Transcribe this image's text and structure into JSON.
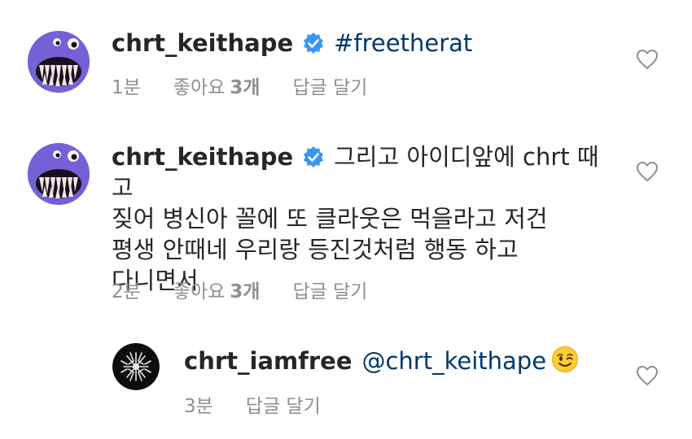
{
  "comments": [
    {
      "username": "chrt_keithape",
      "verified": true,
      "text": "#freetherat",
      "time": "1분",
      "likes_label": "좋아요",
      "likes_count": "3개",
      "reply_label": "답글 달기"
    },
    {
      "username": "chrt_keithape",
      "verified": true,
      "text_lines": [
        "그리고 아이디앞에 chrt 때고",
        "짖어 병신아 꼴에 또 클라웃은 먹을라고 저건",
        "평생 안때네 우리랑 등진것처럼 행동 하고",
        "다니면서"
      ],
      "time": "2분",
      "likes_label": "좋아요",
      "likes_count": "3개",
      "reply_label": "답글 달기"
    },
    {
      "username": "chrt_iamfree",
      "verified": false,
      "mention": "@chrt_keithape",
      "emoji": "winking-face-emoji",
      "time": "3분",
      "reply_label": "답글 달기"
    }
  ],
  "colors": {
    "text": "#262626",
    "meta": "#8e8e8e",
    "link": "#00376b",
    "verified_badge": "#3897f0",
    "heart_outline": "#8e8e8e"
  },
  "icons": [
    "avatar-monster",
    "verified-badge-icon",
    "heart-outline-icon",
    "avatar-dark-scribble",
    "winking-face-emoji"
  ]
}
